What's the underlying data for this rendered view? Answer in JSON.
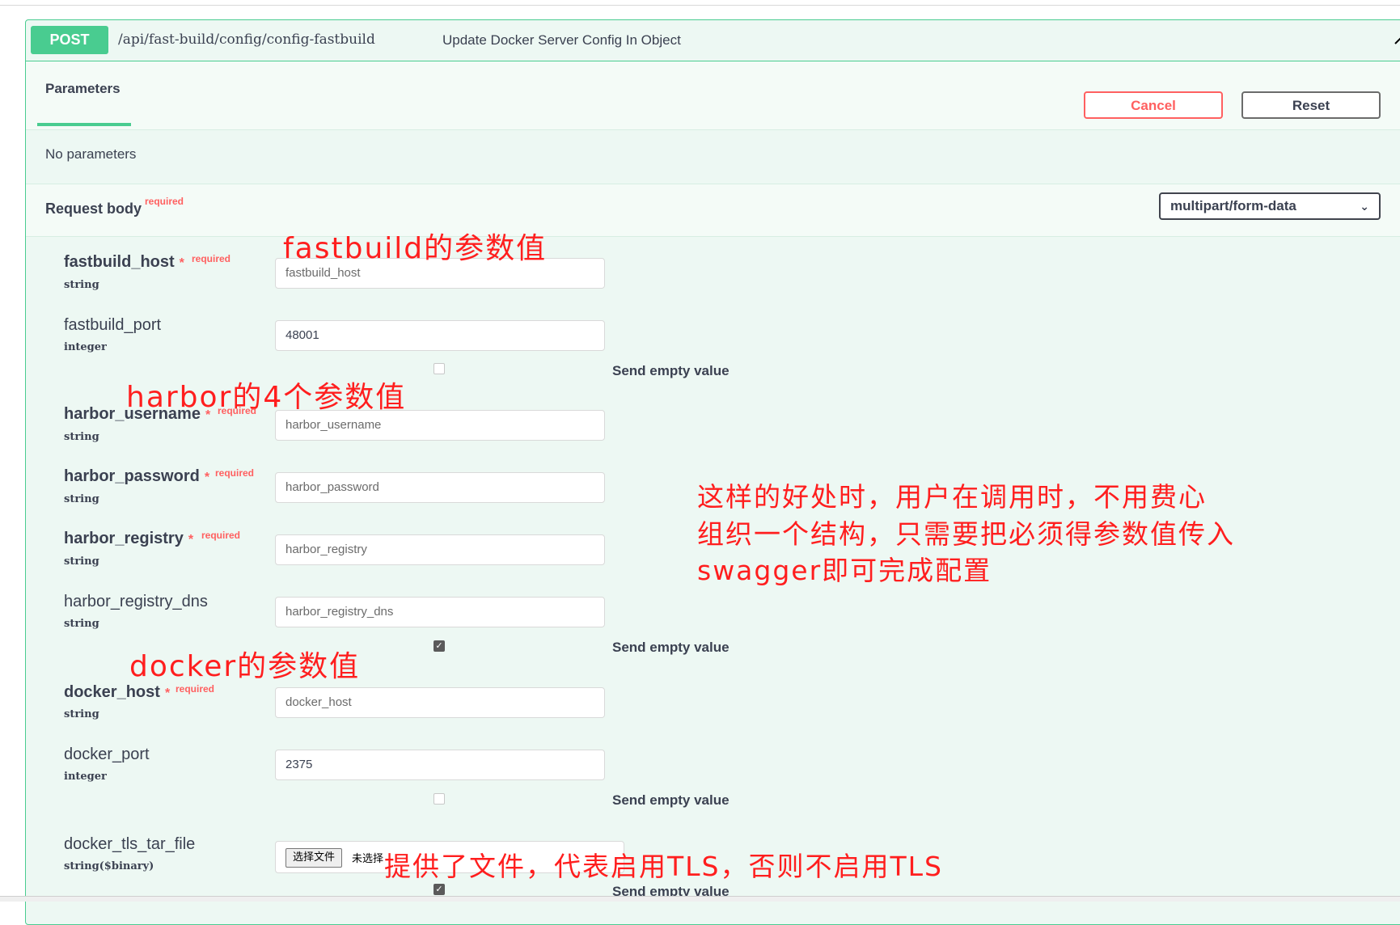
{
  "summary": {
    "method": "POST",
    "path": "/api/fast-build/config/config-fastbuild",
    "description": "Update Docker Server Config In Object"
  },
  "tabs": {
    "parameters": "Parameters"
  },
  "buttons": {
    "cancel": "Cancel",
    "reset": "Reset"
  },
  "no_params": "No parameters",
  "request_body": {
    "title": "Request body",
    "required_label": "required",
    "content_type": "multipart/form-data"
  },
  "params": [
    {
      "name": "fastbuild_host",
      "required": true,
      "required_label": "required",
      "type": "string",
      "value": "",
      "placeholder": "fastbuild_host"
    },
    {
      "name": "fastbuild_port",
      "required": false,
      "type": "integer",
      "value": "48001",
      "send_empty": false
    },
    {
      "name": "harbor_username",
      "required": true,
      "required_label": "required",
      "type": "string",
      "value": "",
      "placeholder": "harbor_username"
    },
    {
      "name": "harbor_password",
      "required": true,
      "required_label": "required",
      "type": "string",
      "value": "",
      "placeholder": "harbor_password"
    },
    {
      "name": "harbor_registry",
      "required": true,
      "required_label": "required",
      "type": "string",
      "value": "",
      "placeholder": "harbor_registry"
    },
    {
      "name": "harbor_registry_dns",
      "required": false,
      "type": "string",
      "value": "",
      "placeholder": "harbor_registry_dns",
      "send_empty": true
    },
    {
      "name": "docker_host",
      "required": true,
      "required_label": "required",
      "type": "string",
      "value": "",
      "placeholder": "docker_host"
    },
    {
      "name": "docker_port",
      "required": false,
      "type": "integer",
      "value": "2375",
      "send_empty": false
    },
    {
      "name": "docker_tls_tar_file",
      "required": false,
      "type": "string($binary)",
      "file_button": "选择文件",
      "file_status": "未选择",
      "send_empty": true
    }
  ],
  "send_empty_label": "Send empty value",
  "annotations": {
    "fastbuild": "fastbuild的参数值",
    "harbor": "harbor的4个参数值",
    "docker": "docker的参数值",
    "benefit_line1": "这样的好处时，用户在调用时，不用费心",
    "benefit_line2": "组织一个结构，只需要把必须得参数值传入",
    "benefit_line3": "swagger即可完成配置",
    "tls": "提供了文件，代表启用TLS，否则不启用TLS"
  },
  "colors": {
    "post": "#49cc90",
    "cancel": "#ff6060",
    "annotation": "#ff1e1e",
    "background": "#edf8f3"
  }
}
